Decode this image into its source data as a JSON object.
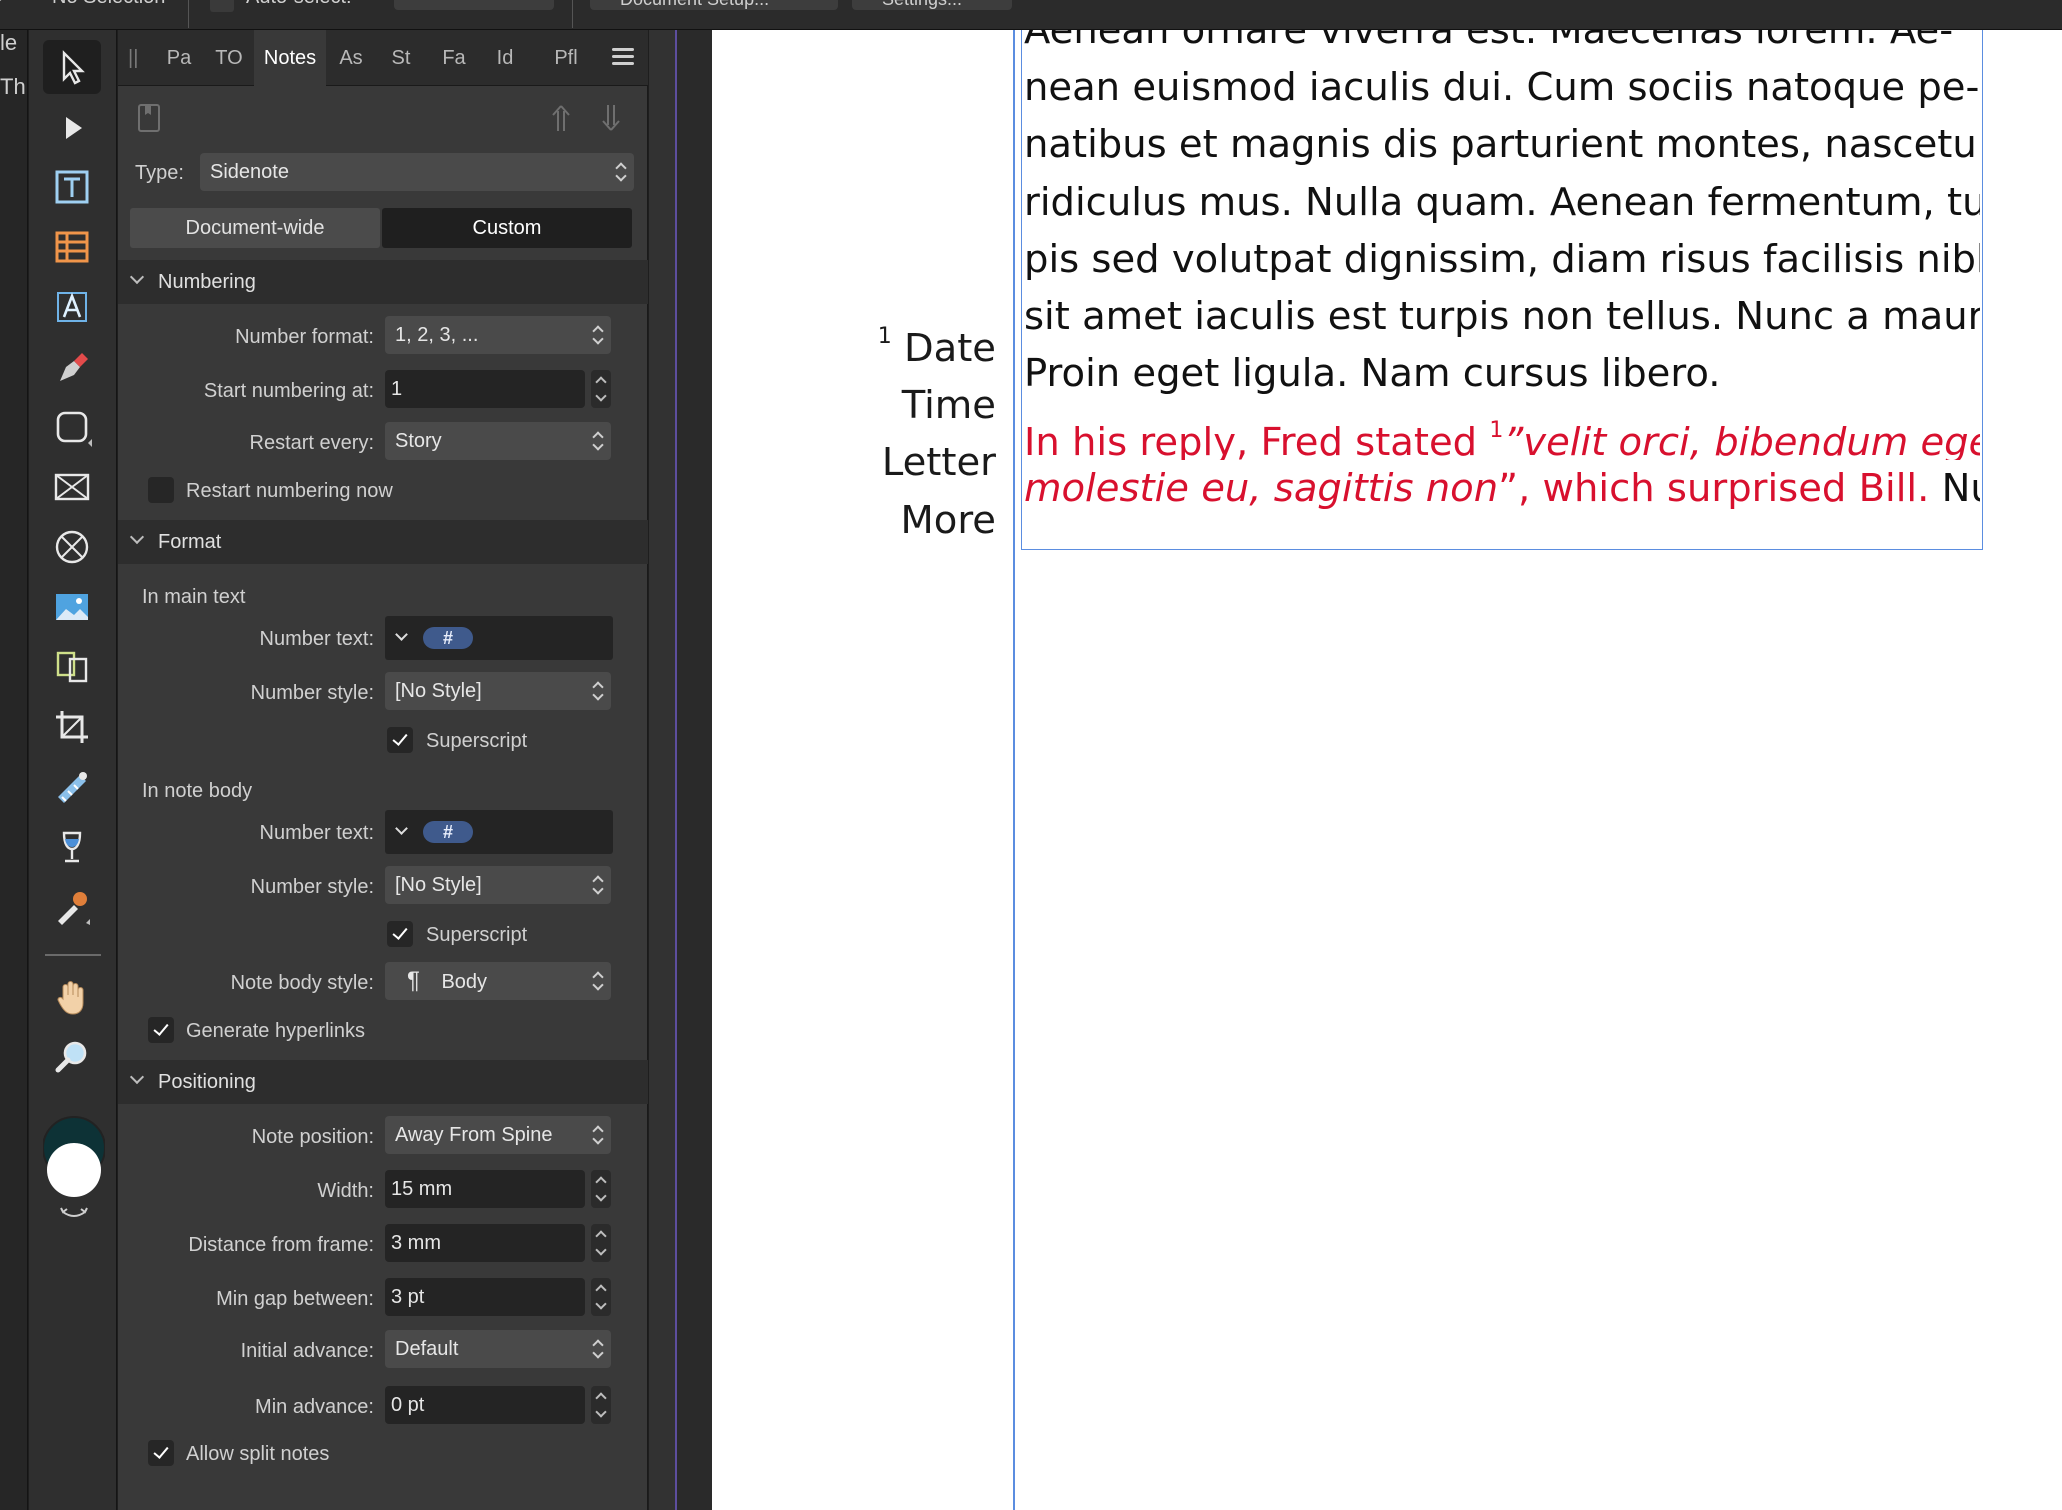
{
  "topbar": {
    "selection": "No Selection",
    "auto_select": "Auto-select:",
    "document_setup": "Document Setup...",
    "settings": "Settings..."
  },
  "leftstrip": {
    "line1": "le",
    "line2": "Thu"
  },
  "panel": {
    "tabs": [
      "Pa",
      "TO",
      "Notes",
      "As",
      "St",
      "Fa",
      "Id",
      "Pfl"
    ],
    "active_tab": "Notes",
    "type_label": "Type:",
    "type_value": "Sidenote",
    "scope_doc": "Document-wide",
    "scope_custom": "Custom",
    "numbering": {
      "title": "Numbering",
      "number_format_label": "Number format:",
      "number_format_value": "1, 2, 3, ...",
      "start_label": "Start numbering at:",
      "start_value": "1",
      "restart_label": "Restart every:",
      "restart_value": "Story",
      "restart_now_label": "Restart numbering now"
    },
    "format": {
      "title": "Format",
      "main_heading": "In main text",
      "number_text_label": "Number text:",
      "token": "#",
      "number_style_label": "Number style:",
      "number_style_value": "[No Style]",
      "superscript_label": "Superscript",
      "note_heading": "In note body",
      "note_body_style_label": "Note body style:",
      "note_body_style_value": "Body",
      "pilcrow": "¶",
      "hyperlinks_label": "Generate hyperlinks"
    },
    "positioning": {
      "title": "Positioning",
      "note_position_label": "Note position:",
      "note_position_value": "Away From Spine",
      "width_label": "Width:",
      "width_value": "15 mm",
      "distance_label": "Distance from frame:",
      "distance_value": "3 mm",
      "min_gap_label": "Min gap between:",
      "min_gap_value": "3 pt",
      "initial_advance_label": "Initial advance:",
      "initial_advance_value": "Default",
      "min_advance_label": "Min advance:",
      "min_advance_value": "0 pt",
      "allow_split_label": "Allow split notes"
    }
  },
  "document": {
    "lines": [
      "Aenean ornare viverra est. Maecenas lorem. Ae-",
      "nean euismod iaculis dui. Cum sociis natoque pe-",
      "natibus et magnis dis parturient montes, nascetur",
      "ridiculus mus. Nulla quam. Aenean fermentum, tur-",
      "pis sed volutpat dignissim, diam risus facilisis nibh,",
      "sit amet iaculis est turpis non tellus. Nunc a mauris.",
      "Proin eget ligula. Nam cursus libero."
    ],
    "red_line1_a": "In his reply, Fred stated ",
    "note_ref": "1",
    "red_line1_b": "”velit orci, bibendum eget,",
    "red_line2_a": "molestie eu, sagittis non",
    "red_line2_b": "”, which surprised Bill.",
    "black_tail": " Nul-",
    "sidenote_num": "1",
    "sidenote_lines": [
      "Date",
      "Time",
      "Letter",
      "More"
    ]
  },
  "colors": {
    "panel_bg": "#393939",
    "accent_blue": "#5b8de0",
    "token_blue": "#3f5a8c",
    "red_text": "#d8102e"
  }
}
